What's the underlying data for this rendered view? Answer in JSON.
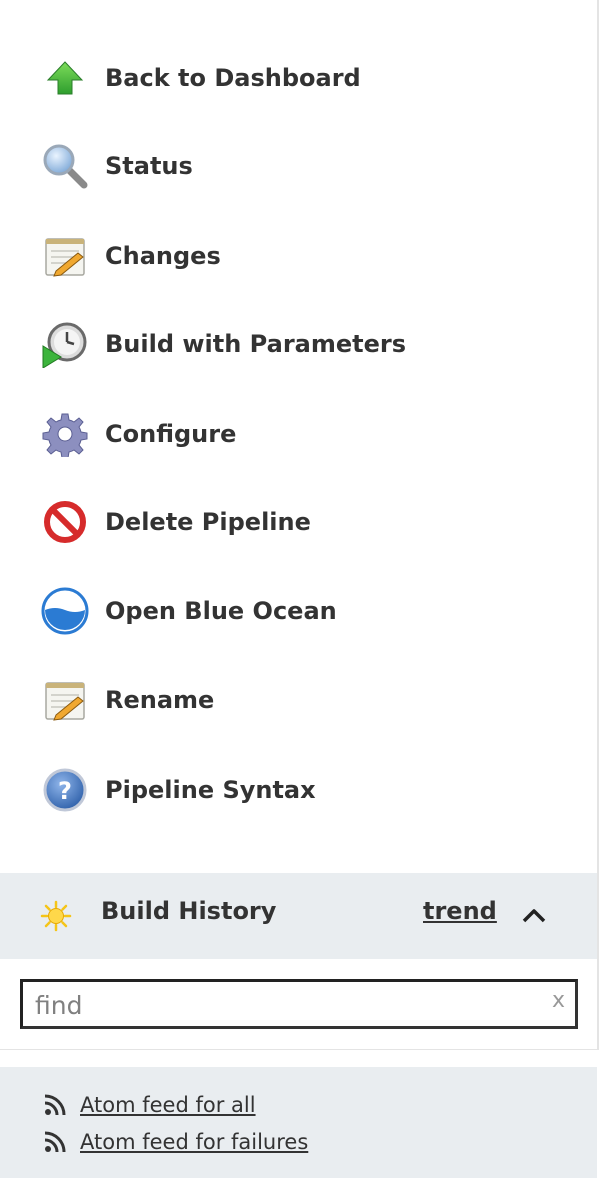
{
  "tasks": [
    {
      "label": "Back to Dashboard",
      "icon": "up-arrow-icon"
    },
    {
      "label": "Status",
      "icon": "magnifier-icon"
    },
    {
      "label": "Changes",
      "icon": "notepad-icon"
    },
    {
      "label": "Build with Parameters",
      "icon": "clock-play-icon"
    },
    {
      "label": "Configure",
      "icon": "gear-icon"
    },
    {
      "label": "Delete Pipeline",
      "icon": "no-entry-icon"
    },
    {
      "label": "Open Blue Ocean",
      "icon": "blue-ocean-icon"
    },
    {
      "label": "Rename",
      "icon": "notepad-icon"
    },
    {
      "label": "Pipeline Syntax",
      "icon": "help-icon"
    }
  ],
  "build_history": {
    "title": "Build History",
    "trend_label": "trend",
    "icon": "sun-icon",
    "collapse_icon": "chevron-up-icon"
  },
  "search": {
    "placeholder": "find",
    "value": "",
    "clear_label": "x"
  },
  "feeds": [
    {
      "label": "Atom feed for all",
      "icon": "rss-icon"
    },
    {
      "label": "Atom feed for failures",
      "icon": "rss-icon"
    }
  ],
  "colors": {
    "panel_bg": "#e9edf0",
    "text": "#333333",
    "arrow_green": "#3bb53b",
    "blue_ocean": "#2b7bd3",
    "no_entry_red": "#d62b2b"
  }
}
